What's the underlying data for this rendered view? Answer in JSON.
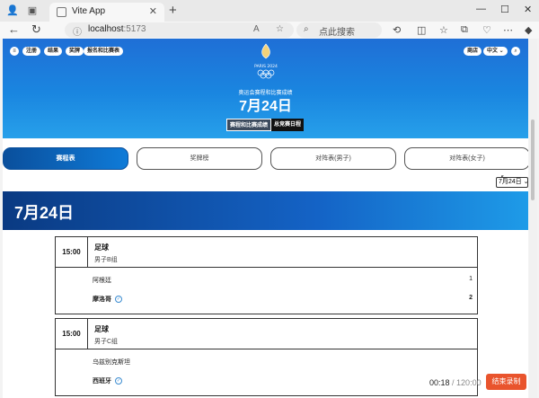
{
  "browser": {
    "tab_title": "Vite App",
    "url_host": "localhost",
    "url_port": ":5173",
    "search_placeholder": "点此搜索"
  },
  "hero": {
    "top_left_buttons": [
      "注册",
      "结果",
      "奖牌",
      "报名和比赛表"
    ],
    "top_right_buttons": [
      "商店",
      "中文 ⌄"
    ],
    "logo_text": "PARIS 2024",
    "subtitle": "奥运会赛程和比赛成绩",
    "date": "7月24日",
    "btn_schedule": "赛程和比赛成绩",
    "btn_overview": "总竞赛日程"
  },
  "tabs": [
    {
      "label": "赛程表",
      "active": true
    },
    {
      "label": "奖牌榜",
      "active": false
    },
    {
      "label": "对阵表(男子)",
      "active": false
    },
    {
      "label": "对阵表(女子)",
      "active": false
    }
  ],
  "date_select": {
    "value": "7月24日"
  },
  "day_title": "7月24日",
  "matches": [
    {
      "time": "15:00",
      "sport": "足球",
      "group": "男子B组",
      "team1": "阿根廷",
      "score1": "1",
      "team2": "摩洛哥",
      "score2": "2"
    },
    {
      "time": "15:00",
      "sport": "足球",
      "group": "男子C组",
      "team1": "乌兹别克斯坦",
      "score1": "",
      "team2": "西班牙",
      "score2": ""
    }
  ],
  "recorder": {
    "elapsed": "00:18",
    "separator": " / ",
    "total": "120:00",
    "stop_label": "结束录制"
  },
  "colors": {
    "accent": "#1a86e0",
    "record": "#e9542d"
  }
}
